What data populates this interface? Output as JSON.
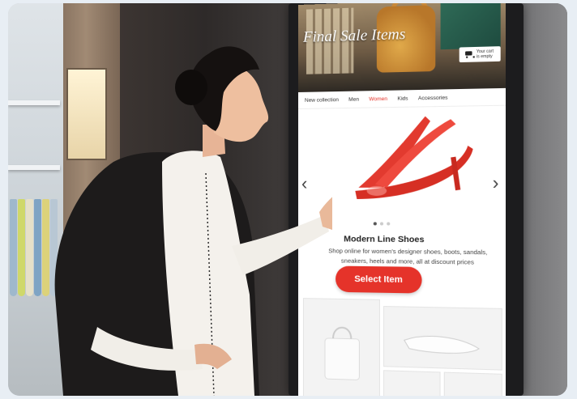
{
  "kiosk": {
    "hero_title": "Final Sale Items",
    "cart_text": "Your cart is empty",
    "nav": [
      {
        "label": "New collection",
        "active": false
      },
      {
        "label": "Men",
        "active": false
      },
      {
        "label": "Women",
        "active": true
      },
      {
        "label": "Kids",
        "active": false
      },
      {
        "label": "Accessories",
        "active": false
      }
    ],
    "product_name": "Modern Line Shoes",
    "product_desc": "Shop online for women's designer shoes, boots, sandals, sneakers, heels and more, all at discount prices",
    "select_button": "Select Item",
    "prev_arrow": "‹",
    "next_arrow": "›"
  },
  "colors": {
    "accent": "#e5332a",
    "shoe": "#e23a2f"
  },
  "icons": [
    "cart-icon",
    "chevron-left-icon",
    "chevron-right-icon"
  ]
}
